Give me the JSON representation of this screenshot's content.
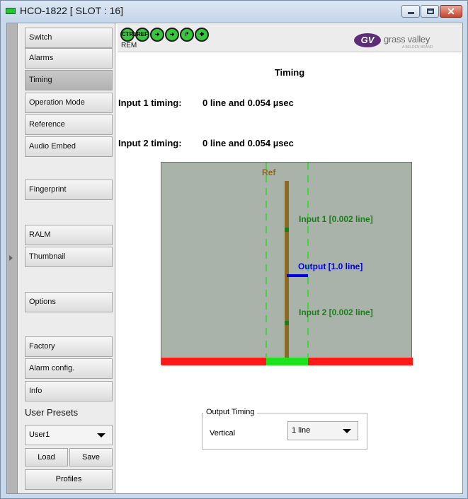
{
  "window": {
    "title": "HCO-1822 [ SLOT : 16]",
    "close_glyph": "✕"
  },
  "nav": {
    "items": [
      {
        "label": "Switch",
        "selected": false
      },
      {
        "label": "Alarms",
        "selected": false
      },
      {
        "label": "Timing",
        "selected": true
      },
      {
        "label": "Operation Mode",
        "selected": false
      },
      {
        "label": "Reference",
        "selected": false
      },
      {
        "label": "Audio Embed",
        "selected": false
      },
      {
        "label": "Fingerprint",
        "selected": false
      },
      {
        "label": "RALM",
        "selected": false
      },
      {
        "label": "Thumbnail",
        "selected": false
      },
      {
        "label": "Options",
        "selected": false
      },
      {
        "label": "Factory",
        "selected": false
      },
      {
        "label": "Alarm config.",
        "selected": false
      },
      {
        "label": "Info",
        "selected": false
      }
    ],
    "presets": {
      "label": "User Presets",
      "selected": "User1",
      "load_label": "Load",
      "save_label": "Save",
      "profiles_label": "Profiles"
    }
  },
  "status": {
    "icons": [
      {
        "name": "ctrl-status-icon",
        "text": "CTRL"
      },
      {
        "name": "ref-status-icon",
        "text": "REF"
      },
      {
        "name": "input1-arrow-icon",
        "text": ""
      },
      {
        "name": "input2-arrow-icon",
        "text": ""
      },
      {
        "name": "output-arrow-icon",
        "text": ""
      },
      {
        "name": "plus-status-icon",
        "text": ""
      }
    ],
    "rem_label": "REM",
    "logo": {
      "brand": "grass valley",
      "sub": "A BELDEN BRAND",
      "mark": "GV"
    }
  },
  "timing": {
    "title": "Timing",
    "input1": {
      "label": "Input 1 timing:",
      "value": "0 line and 0.054 µsec"
    },
    "input2": {
      "label": "Input 2 timing:",
      "value": "0 line and 0.054 µsec"
    }
  },
  "diagram": {
    "ref_label": "Ref",
    "input1_label": "Input 1 [0.002 line]",
    "output_label": "Output [1.0 line]",
    "input2_label": "Input 2 [0.002 line]",
    "colors": {
      "background": "#a9b3a9",
      "ref_bar": "#8b6a24",
      "input": "#1a7f1a",
      "output": "#0000e0",
      "guide": "#1fe21f",
      "bar_red": "#ff1a1a",
      "bar_green": "#1fe21f"
    }
  },
  "output_timing": {
    "group_label": "Output Timing",
    "vertical_label": "Vertical",
    "vertical_value": "1 line"
  }
}
